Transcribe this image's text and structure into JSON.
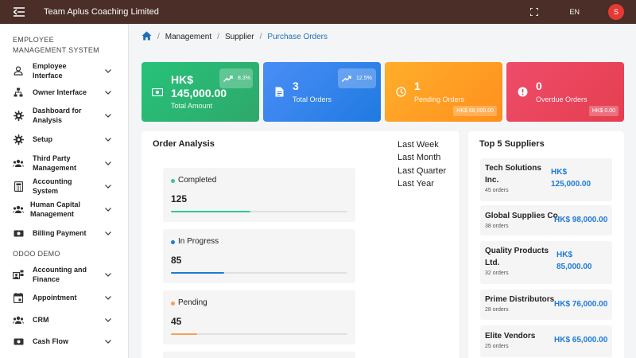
{
  "header": {
    "app_title": "Team Aplus Coaching Limited",
    "language": "EN",
    "avatar_initial": "S"
  },
  "sidebar": {
    "section_1": "EMPLOYEE MANAGEMENT SYSTEM",
    "items_1": [
      {
        "label": "Employee Interface",
        "icon": "person-icon"
      },
      {
        "label": "Owner Interface",
        "icon": "org-chart-icon"
      },
      {
        "label": "Dashboard for Analysis",
        "icon": "gear-icon"
      },
      {
        "label": "Setup",
        "icon": "gear-icon"
      },
      {
        "label": "Third Party Management",
        "icon": "group-icon"
      },
      {
        "label": "Accounting System",
        "icon": "calculator-icon"
      },
      {
        "label": "Human Capital Management",
        "icon": "group-icon"
      },
      {
        "label": "Billing Payment",
        "icon": "money-icon"
      }
    ],
    "section_2": "ODOO DEMO",
    "items_2": [
      {
        "label": "Accounting and Finance",
        "icon": "finance-icon"
      },
      {
        "label": "Appointment",
        "icon": "calendar-icon"
      },
      {
        "label": "CRM",
        "icon": "group-icon"
      },
      {
        "label": "Cash Flow",
        "icon": "money-icon"
      }
    ]
  },
  "breadcrumb": {
    "items": [
      "Management",
      "Supplier"
    ],
    "current": "Purchase Orders"
  },
  "stats": {
    "total_amount": {
      "value": "HK$ 145,000.00",
      "label": "Total Amount",
      "trend": "8.3%"
    },
    "total_orders": {
      "value": "3",
      "label": "Total Orders",
      "trend": "12.5%"
    },
    "pending_orders": {
      "value": "1",
      "label": "Pending Orders",
      "tag": "HK$ 68,000.00"
    },
    "overdue_orders": {
      "value": "0",
      "label": "Overdue Orders",
      "tag": "HK$ 0.00"
    }
  },
  "order_analysis": {
    "title": "Order Analysis",
    "periods": [
      "Last Week",
      "Last Month",
      "Last Quarter",
      "Last Year"
    ],
    "statuses": [
      {
        "name": "Completed",
        "count": "125",
        "progress": 0.45,
        "color": "#2ecc8f"
      },
      {
        "name": "In Progress",
        "count": "85",
        "progress": 0.3,
        "color": "#1e7ad6"
      },
      {
        "name": "Pending",
        "count": "45",
        "progress": 0.15,
        "color": "#f5a05a"
      }
    ]
  },
  "top_suppliers": {
    "title": "Top 5 Suppliers",
    "items": [
      {
        "name_1": "Tech Solutions",
        "name_2": "Inc.",
        "orders": "45 orders",
        "amt_1": "HK$",
        "amt_2": "125,000.00"
      },
      {
        "name_1": "Global Supplies Co.",
        "name_2": "",
        "orders": "38 orders",
        "amt_1": "HK$ 98,000.00",
        "amt_2": ""
      },
      {
        "name_1": "Quality Products",
        "name_2": "Ltd.",
        "orders": "32 orders",
        "amt_1": "HK$",
        "amt_2": "85,000.00"
      },
      {
        "name_1": "Prime Distributors",
        "name_2": "",
        "orders": "28 orders",
        "amt_1": "HK$ 76,000.00",
        "amt_2": ""
      },
      {
        "name_1": "Elite Vendors",
        "name_2": "",
        "orders": "25 orders",
        "amt_1": "HK$ 65,000.00",
        "amt_2": ""
      }
    ]
  },
  "colors": {
    "topbar": "#4a2e27",
    "accent_blue": "#1e7ad6",
    "green": "#2ea86b",
    "blue": "#1f7ae0",
    "orange": "#ff8f1c",
    "red": "#e53e4f"
  }
}
